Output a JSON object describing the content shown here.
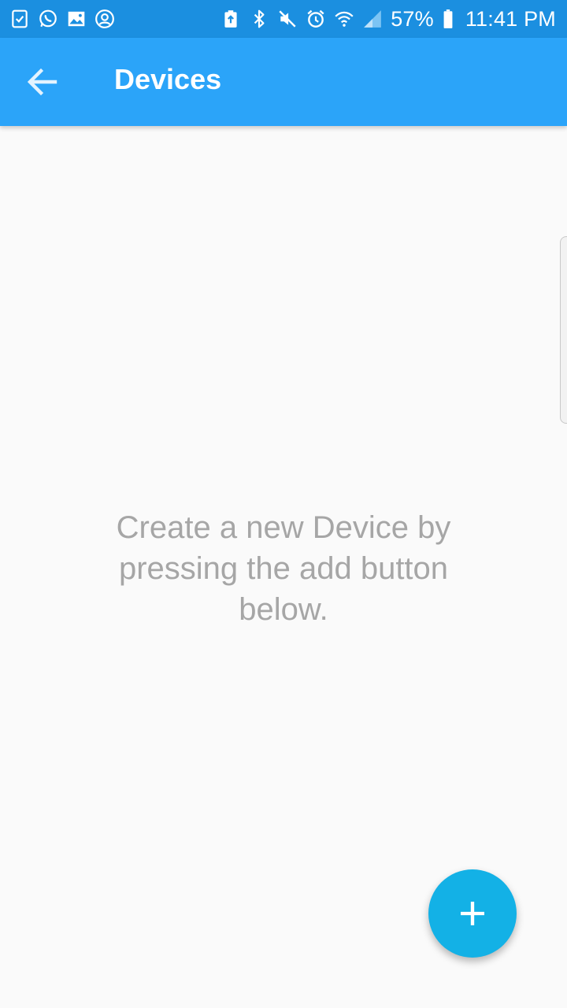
{
  "status_bar": {
    "left_icons": [
      "task-check-icon",
      "whatsapp-icon",
      "gallery-icon",
      "account-circle-icon"
    ],
    "right_icons": [
      "battery-saver-icon",
      "bluetooth-icon",
      "mute-icon",
      "alarm-icon",
      "wifi-icon",
      "signal-icon"
    ],
    "battery_percent": "57%",
    "time": "11:41 PM",
    "background_color": "#1b8fe0"
  },
  "app_bar": {
    "title": "Devices",
    "back_icon": "arrow-back-icon",
    "background_color": "#2ba4f9"
  },
  "main": {
    "empty_message": "Create a new Device by pressing the add button below."
  },
  "fab": {
    "icon": "plus-icon",
    "background_color": "#13b1e6"
  }
}
